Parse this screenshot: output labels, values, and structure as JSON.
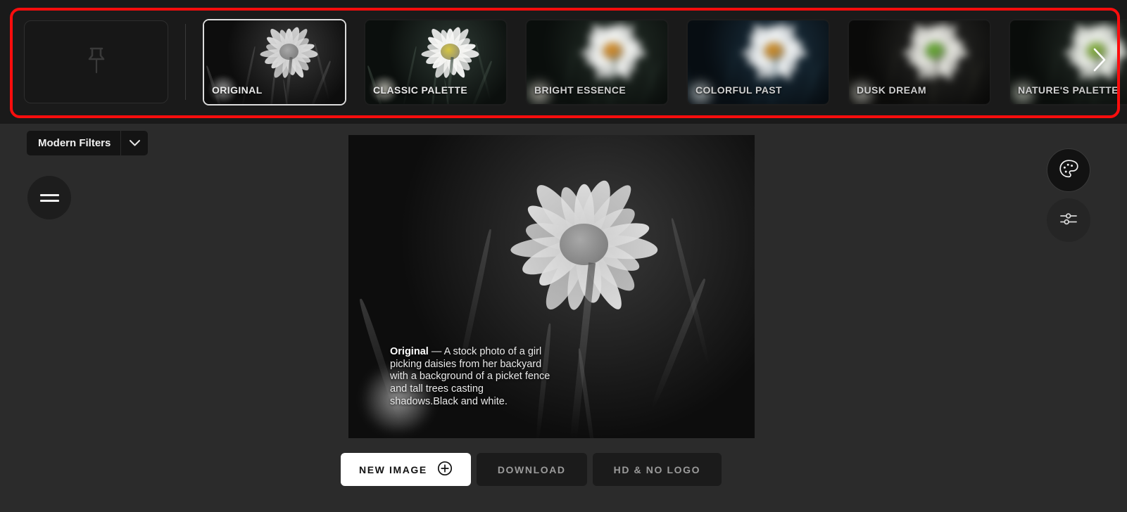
{
  "theme": {
    "page_bg": "#2b2b2b",
    "strip_bg": "#1a1a1a",
    "highlight_border": "#fc0d0d",
    "accent_text": "#ffffff",
    "muted_text": "#9b9b9b"
  },
  "filter_strip": {
    "pin_card": {
      "icon": "pushpin-icon"
    },
    "next_arrow": {
      "icon": "chevron-right-icon"
    },
    "thumbnails": [
      {
        "label": "ORIGINAL",
        "selected": true,
        "blurred": false,
        "style": "mono"
      },
      {
        "label": "CLASSIC PALETTE",
        "selected": false,
        "blurred": false,
        "style": "classic"
      },
      {
        "label": "BRIGHT ESSENCE",
        "selected": false,
        "blurred": true,
        "style": "bright"
      },
      {
        "label": "COLORFUL PAST",
        "selected": false,
        "blurred": true,
        "style": "colorful"
      },
      {
        "label": "DUSK DREAM",
        "selected": false,
        "blurred": true,
        "style": "dusk"
      },
      {
        "label": "NATURE'S PALETTE",
        "selected": false,
        "blurred": true,
        "style": "nature"
      }
    ]
  },
  "controls": {
    "filters_dropdown": {
      "selected": "Modern Filters",
      "caret_icon": "chevron-down-icon"
    },
    "menu_button": {
      "icon": "hamburger-menu-icon"
    }
  },
  "preview": {
    "caption_title": "Original",
    "caption_dash": " — ",
    "caption_text": "A stock photo of a girl picking daisies from her backyard with a background of a picket fence and tall trees casting shadows.Black and white."
  },
  "actions": {
    "new_image": {
      "label": "NEW IMAGE",
      "icon": "plus-circle-icon"
    },
    "download": {
      "label": "DOWNLOAD"
    },
    "hd_no_logo": {
      "label": "HD & NO LOGO"
    }
  },
  "side_tools": {
    "palette": {
      "icon": "palette-icon"
    },
    "adjust": {
      "icon": "sliders-icon"
    }
  }
}
